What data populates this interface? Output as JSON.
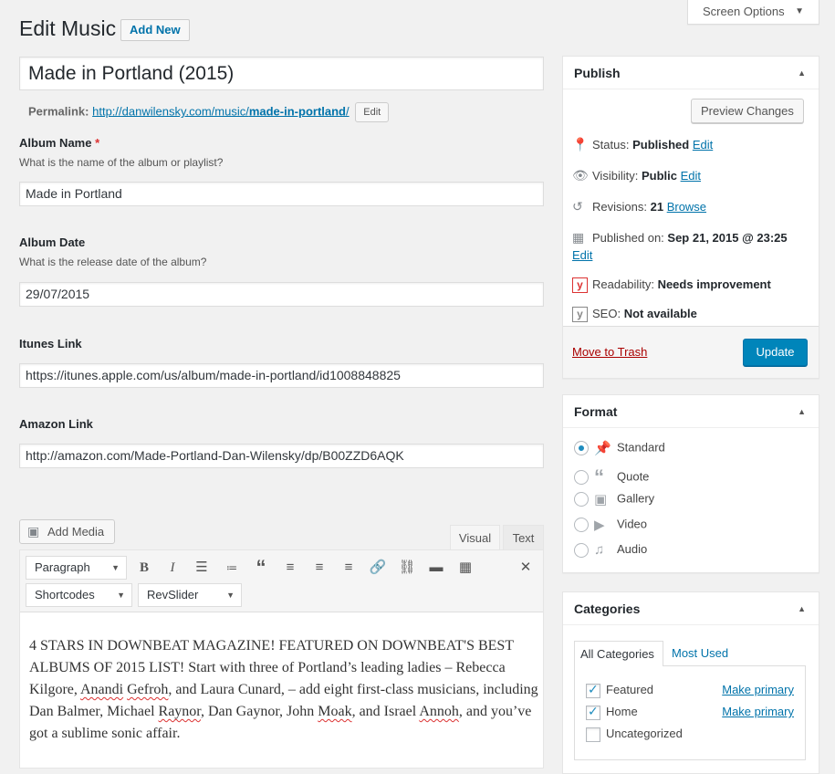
{
  "header": {
    "title": "Edit Music",
    "add_new_label": "Add New",
    "screen_options_label": "Screen Options"
  },
  "post": {
    "title": "Made in Portland (2015)",
    "permalink_label": "Permalink:",
    "permalink_base": "http://danwilensky.com/music/",
    "permalink_slug": "made-in-portland",
    "permalink_trailing": "/",
    "permalink_edit_label": "Edit"
  },
  "fields": {
    "album_name": {
      "label": "Album Name",
      "required": "*",
      "description": "What is the name of the album or playlist?",
      "value": "Made in Portland"
    },
    "album_date": {
      "label": "Album Date",
      "description": "What is the release date of the album?",
      "value": "29/07/2015"
    },
    "itunes": {
      "label": "Itunes Link",
      "value": "https://itunes.apple.com/us/album/made-in-portland/id1008848825"
    },
    "amazon": {
      "label": "Amazon Link",
      "value": "http://amazon.com/Made-Portland-Dan-Wilensky/dp/B00ZZD6AQK"
    }
  },
  "editor": {
    "add_media_label": "Add Media",
    "tab_visual": "Visual",
    "tab_text": "Text",
    "format_select": "Paragraph",
    "shortcodes_select": "Shortcodes",
    "revslider_select": "RevSlider",
    "content": {
      "p1": "4 STARS IN DOWNBEAT MAGAZINE! FEATURED ON DOWNBEAT'S BEST ALBUMS OF 2015 LIST!  Start with three of Portland’s leading ladies – Rebecca Kilgore, ",
      "w1": "Anandi",
      "s1": " ",
      "w2": "Gefroh",
      "p2": ", and Laura Cunard, – add eight first-class musicians, including Dan Balmer, Michael ",
      "w3": "Raynor",
      "p3": ", Dan Gaynor, John ",
      "w4": "Moak",
      "p4": ", and Israel ",
      "w5": "Annoh",
      "p5": ", and you’ve got a sublime sonic affair."
    }
  },
  "publish": {
    "title": "Publish",
    "preview_label": "Preview Changes",
    "status_label": "Status:",
    "status_value": "Published",
    "visibility_label": "Visibility:",
    "visibility_value": "Public",
    "revisions_label": "Revisions:",
    "revisions_value": "21",
    "browse_label": "Browse",
    "published_label": "Published on:",
    "published_value": "Sep 21, 2015 @ 23:25",
    "edit_label": "Edit",
    "readability_label": "Readability:",
    "readability_value": "Needs improvement",
    "seo_label": "SEO:",
    "seo_value": "Not available",
    "trash_label": "Move to Trash",
    "update_label": "Update"
  },
  "format": {
    "title": "Format",
    "options": [
      "Standard",
      "Quote",
      "Gallery",
      "Video",
      "Audio"
    ],
    "selected": "Standard"
  },
  "categories": {
    "title": "Categories",
    "tab_all": "All Categories",
    "tab_most_used": "Most Used",
    "items": [
      {
        "name": "Featured",
        "checked": true,
        "make_primary": "Make primary"
      },
      {
        "name": "Home",
        "checked": true,
        "make_primary": "Make primary"
      },
      {
        "name": "Uncategorized",
        "checked": false,
        "make_primary": ""
      }
    ]
  },
  "colors": {
    "primary": "#0085ba",
    "link": "#0073aa",
    "trash": "#a00000",
    "required": "#dc3232"
  }
}
